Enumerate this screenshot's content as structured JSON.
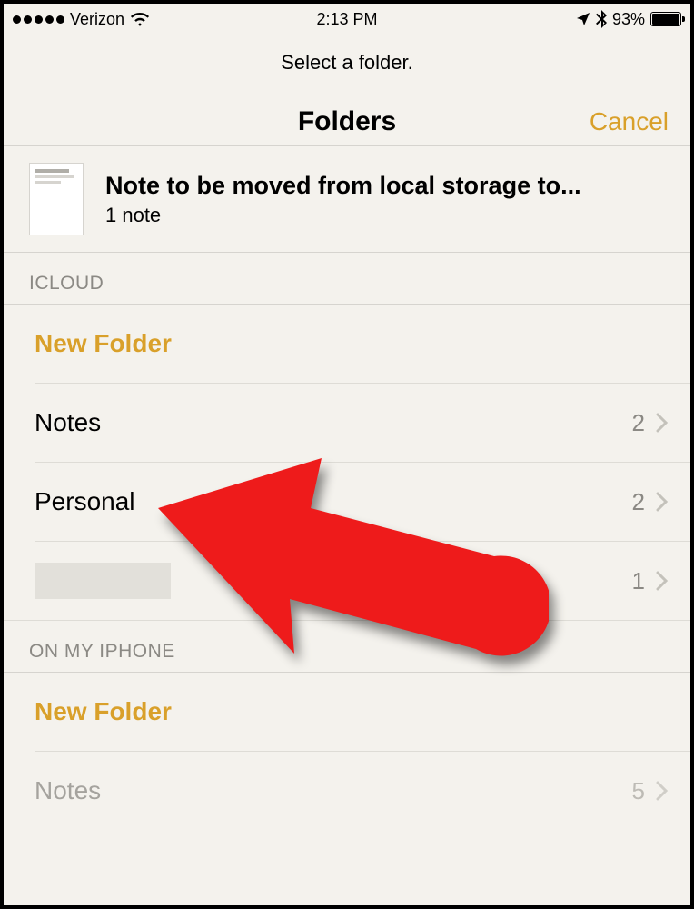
{
  "status_bar": {
    "carrier": "Verizon",
    "time": "2:13 PM",
    "battery_percent": "93%"
  },
  "instruction": "Select a folder.",
  "navbar": {
    "title": "Folders",
    "cancel": "Cancel"
  },
  "note": {
    "title": "Note to be moved from local storage to...",
    "count_text": "1 note"
  },
  "sections": {
    "icloud": {
      "header": "ICLOUD",
      "new_folder": "New Folder",
      "rows": [
        {
          "label": "Notes",
          "count": "2"
        },
        {
          "label": "Personal",
          "count": "2"
        },
        {
          "label": "",
          "count": "1",
          "redacted": true
        }
      ]
    },
    "on_my_iphone": {
      "header": "ON MY IPHONE",
      "new_folder": "New Folder",
      "rows": [
        {
          "label": "Notes",
          "count": "5",
          "dim": true
        }
      ]
    }
  }
}
